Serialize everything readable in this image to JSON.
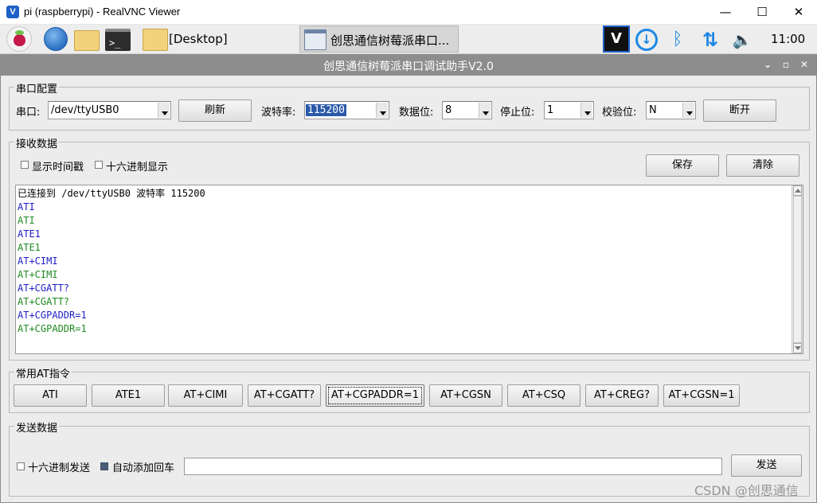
{
  "vnc_window": {
    "title": "pi (raspberrypi) - RealVNC Viewer",
    "minimize": "—",
    "maximize": "☐",
    "close": "✕"
  },
  "taskbar": {
    "desktop_label": "[Desktop]",
    "active_task_label": "创思通信树莓派串口...",
    "clock": "11:00",
    "icons": [
      "raspberry-menu-icon",
      "browser-globe-icon",
      "file-manager-icon",
      "terminal-icon",
      "folder-icon",
      "realvnc-icon",
      "download-icon",
      "bluetooth-icon",
      "network-icon",
      "volume-icon"
    ]
  },
  "app": {
    "title": "创思通信树莓派串口调试助手V2.0",
    "serial_config": {
      "group_title": "串口配置",
      "port_label": "串口:",
      "port_value": "/dev/ttyUSB0",
      "refresh_button": "刷新",
      "baud_label": "波特率:",
      "baud_value": "115200",
      "data_bits_label": "数据位:",
      "data_bits_value": "8",
      "stop_bits_label": "停止位:",
      "stop_bits_value": "1",
      "parity_label": "校验位:",
      "parity_value": "N",
      "disconnect_button": "断开"
    },
    "receive": {
      "group_title": "接收数据",
      "show_timestamp_label": "显示时间戳",
      "show_timestamp_checked": false,
      "hex_display_label": "十六进制显示",
      "hex_display_checked": false,
      "save_button": "保存",
      "clear_button": "清除",
      "lines": [
        {
          "text": "已连接到 /dev/ttyUSB0 波特率 115200",
          "kind": "status"
        },
        {
          "text": "ATI",
          "kind": "sent"
        },
        {
          "text": "ATI",
          "kind": "recv"
        },
        {
          "text": "ATE1",
          "kind": "sent"
        },
        {
          "text": "ATE1",
          "kind": "recv"
        },
        {
          "text": "AT+CIMI",
          "kind": "sent"
        },
        {
          "text": "AT+CIMI",
          "kind": "recv"
        },
        {
          "text": "AT+CGATT?",
          "kind": "sent"
        },
        {
          "text": "AT+CGATT?",
          "kind": "recv"
        },
        {
          "text": "AT+CGPADDR=1",
          "kind": "sent"
        },
        {
          "text": "AT+CGPADDR=1",
          "kind": "recv"
        }
      ]
    },
    "at_commands": {
      "group_title": "常用AT指令",
      "buttons": [
        "ATI",
        "ATE1",
        "AT+CIMI",
        "AT+CGATT?",
        "AT+CGPADDR=1",
        "AT+CGSN",
        "AT+CSQ",
        "AT+CREG?",
        "AT+CGSN=1"
      ],
      "focused_index": 4
    },
    "send": {
      "group_title": "发送数据",
      "hex_send_label": "十六进制发送",
      "hex_send_checked": false,
      "auto_cr_label": "自动添加回车",
      "auto_cr_checked": true,
      "input_value": "",
      "send_button": "发送"
    }
  },
  "colors": {
    "sent_text": "#1e1ec8",
    "recv_text": "#1f8a1f",
    "title_bar": "#8d8d8d",
    "selection": "#2a5aa8"
  },
  "watermark": "CSDN @创思通信"
}
